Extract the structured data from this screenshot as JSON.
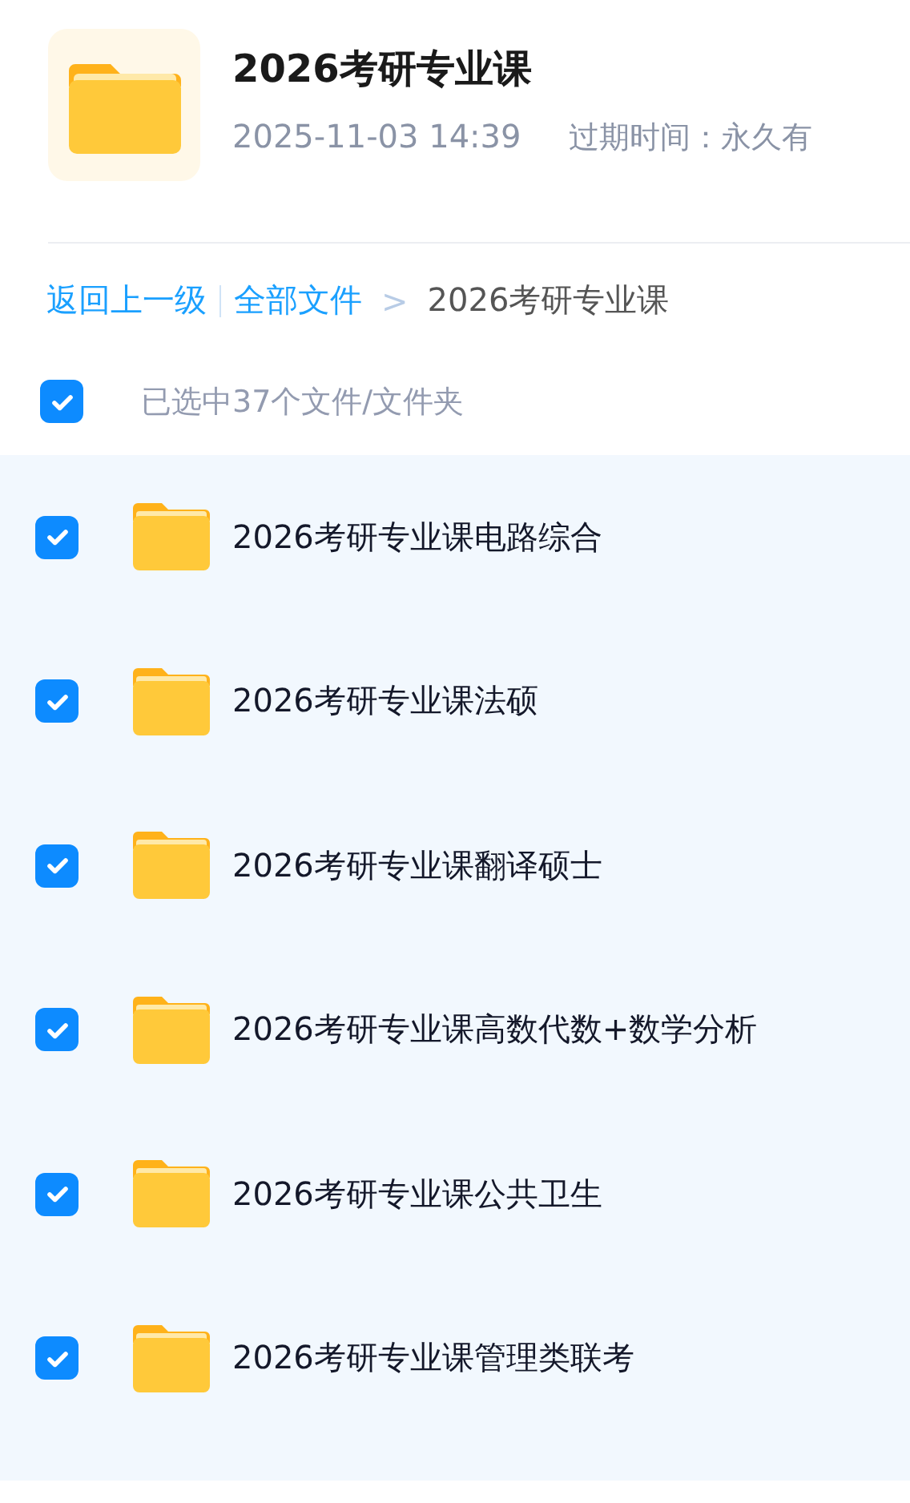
{
  "header": {
    "title": "2026考研专业课",
    "date": "2025-11-03 14:39",
    "expiry_label": "过期时间：",
    "expiry_value": "永久有"
  },
  "breadcrumb": {
    "back": "返回上一级",
    "root": "全部文件",
    "separator": ">",
    "current": "2026考研专业课"
  },
  "select_all": {
    "checked": true,
    "label": "已选中37个文件/文件夹"
  },
  "files": [
    {
      "name": "2026考研专业课电路综合",
      "checked": true
    },
    {
      "name": "2026考研专业课法硕",
      "checked": true
    },
    {
      "name": "2026考研专业课翻译硕士",
      "checked": true
    },
    {
      "name": "2026考研专业课高数代数+数学分析",
      "checked": true
    },
    {
      "name": "2026考研专业课公共卫生",
      "checked": true
    },
    {
      "name": "2026考研专业课管理类联考",
      "checked": true
    }
  ]
}
